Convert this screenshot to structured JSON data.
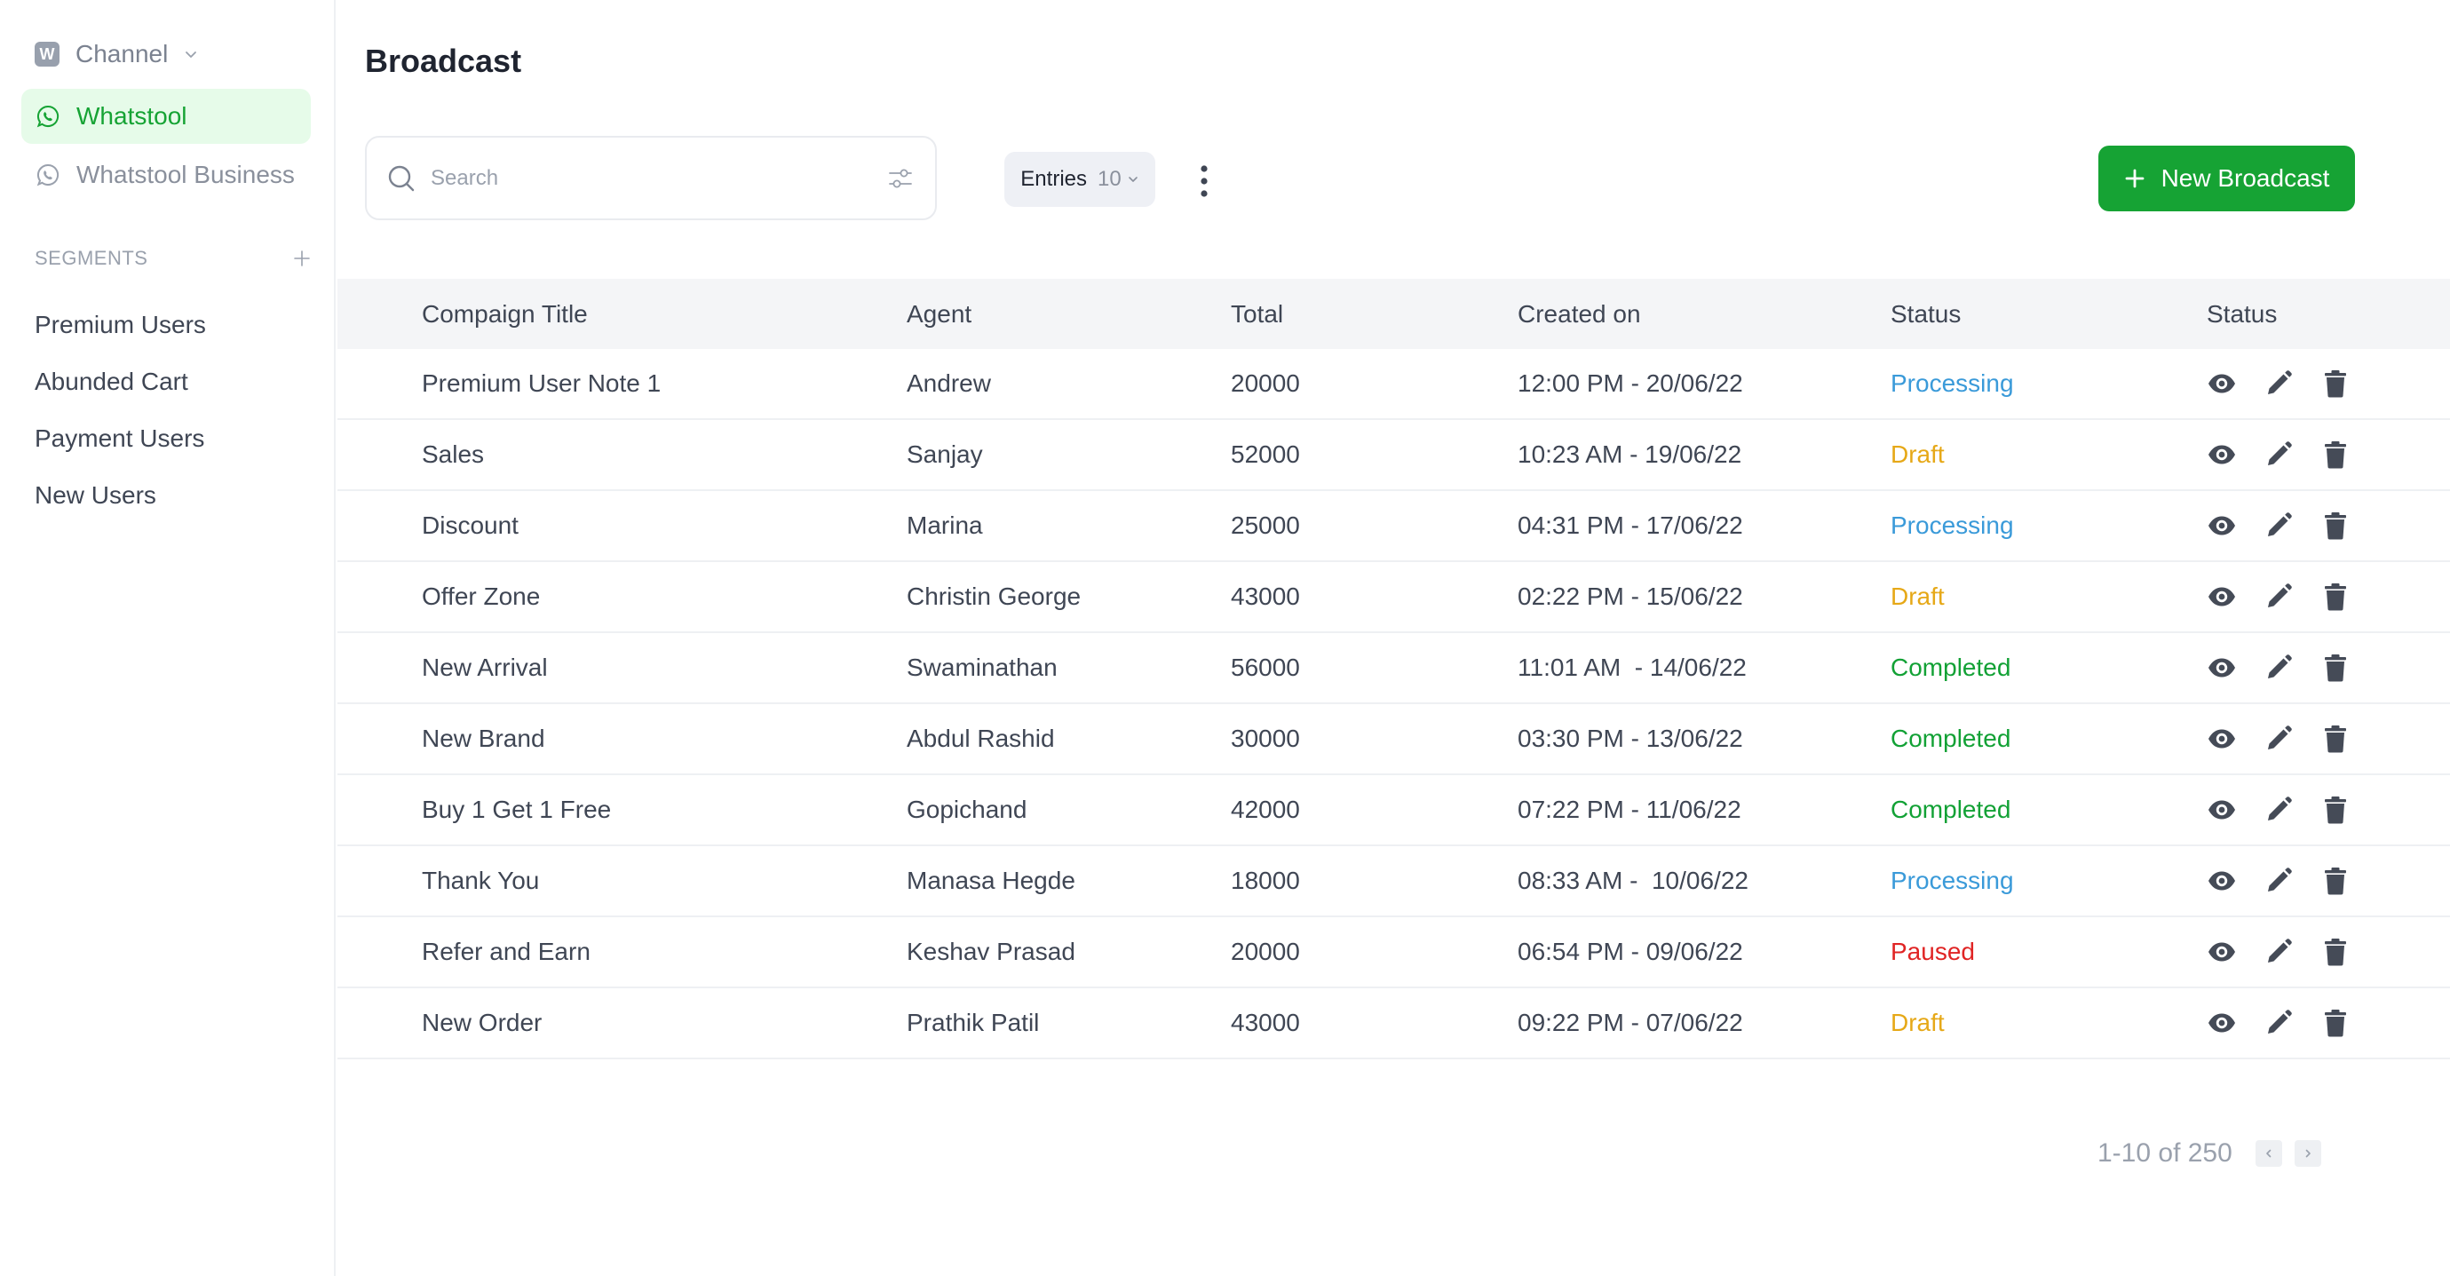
{
  "sidebar": {
    "channel_badge": "W",
    "channel_label": "Channel",
    "nav": [
      {
        "label": "Whatstool",
        "active": true
      },
      {
        "label": "Whatstool Business",
        "active": false
      }
    ],
    "segments_heading": "SEGMENTS",
    "segments": [
      "Premium Users",
      "Abunded Cart",
      "Payment Users",
      "New Users"
    ]
  },
  "header": {
    "title": "Broadcast",
    "search_placeholder": "Search",
    "entries_label": "Entries",
    "entries_value": "10",
    "new_button_label": "New Broadcast"
  },
  "colors": {
    "brand_green": "#16a334",
    "processing": "#3a9ad9",
    "draft": "#e6a817",
    "completed": "#12a135",
    "paused": "#e02424"
  },
  "table": {
    "columns": [
      "Compaign Title",
      "Agent",
      "Total",
      "Created on",
      "Status",
      "Status"
    ],
    "rows": [
      {
        "title": "Premium User Note 1",
        "agent": "Andrew",
        "total": "20000",
        "created": "12:00 PM - 20/06/22",
        "status": "Processing"
      },
      {
        "title": "Sales",
        "agent": "Sanjay",
        "total": "52000",
        "created": "10:23 AM - 19/06/22",
        "status": "Draft"
      },
      {
        "title": "Discount",
        "agent": "Marina",
        "total": "25000",
        "created": "04:31 PM - 17/06/22",
        "status": "Processing"
      },
      {
        "title": "Offer Zone",
        "agent": "Christin George",
        "total": "43000",
        "created": "02:22 PM - 15/06/22",
        "status": "Draft"
      },
      {
        "title": "New Arrival",
        "agent": "Swaminathan",
        "total": "56000",
        "created": "11:01 AM  - 14/06/22",
        "status": "Completed"
      },
      {
        "title": "New Brand",
        "agent": "Abdul Rashid",
        "total": "30000",
        "created": "03:30 PM - 13/06/22",
        "status": "Completed"
      },
      {
        "title": "Buy 1 Get 1 Free",
        "agent": "Gopichand",
        "total": "42000",
        "created": "07:22 PM - 11/06/22",
        "status": "Completed"
      },
      {
        "title": "Thank You",
        "agent": "Manasa Hegde",
        "total": "18000",
        "created": "08:33 AM -  10/06/22",
        "status": "Processing"
      },
      {
        "title": "Refer and Earn",
        "agent": "Keshav Prasad",
        "total": "20000",
        "created": "06:54 PM - 09/06/22",
        "status": "Paused"
      },
      {
        "title": "New Order",
        "agent": "Prathik Patil",
        "total": "43000",
        "created": "09:22 PM - 07/06/22",
        "status": "Draft"
      }
    ],
    "row_actions": [
      "eye-icon",
      "pencil-icon",
      "trash-icon"
    ]
  },
  "pagination": {
    "text": "1-10 of 250"
  }
}
